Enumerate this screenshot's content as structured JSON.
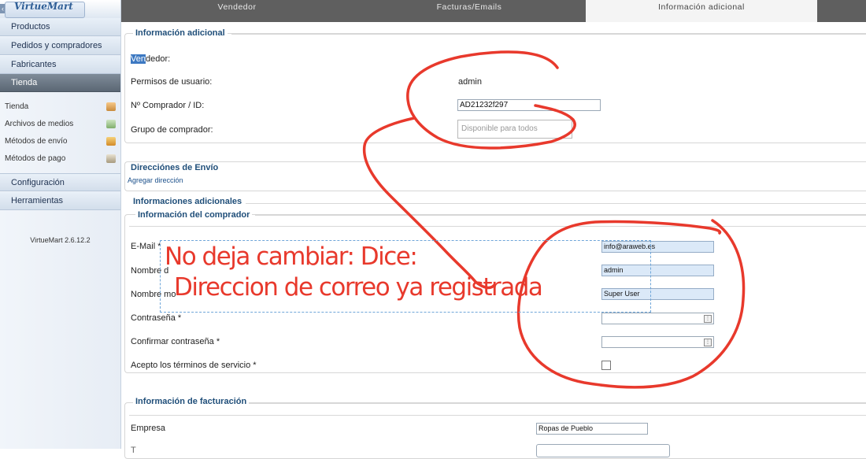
{
  "sidebar": {
    "logo": "VirtueMart",
    "nav_top": [
      "Productos",
      "Pedidos y compradores",
      "Fabricantes",
      "Tienda"
    ],
    "sub_items": [
      {
        "label": "Tienda",
        "icon": "store-icon"
      },
      {
        "label": "Archivos de medios",
        "icon": "media-icon"
      },
      {
        "label": "Métodos de envío",
        "icon": "truck-icon"
      },
      {
        "label": "Métodos de pago",
        "icon": "payment-icon"
      }
    ],
    "nav_bottom": [
      "Configuración",
      "Herramientas"
    ],
    "version": "VirtueMart 2.6.12.2"
  },
  "tabs": [
    "Vendedor",
    "Facturas/Emails",
    "Información adicional"
  ],
  "info_adicional": {
    "title": "Información adicional",
    "vendor_hl": "Ven",
    "vendor_rest": "dedor:",
    "permisos_label": "Permisos de usuario:",
    "permisos_value": "admin",
    "comprador_id_label": "Nº Comprador / ID:",
    "comprador_id_value": "AD21232f297",
    "grupo_label": "Grupo de comprador:",
    "grupo_placeholder": "Disponible para todos"
  },
  "envio": {
    "title": "Direcciónes de Envío",
    "add_link": "Agregar dirección"
  },
  "informaciones": {
    "title": "Informaciones adicionales",
    "sub_title": "Información del comprador",
    "email_label": "E-Mail *",
    "email_value": "info@araweb.es",
    "nombre_label": "Nombre d",
    "nombre_value": "admin",
    "nombre2_label": "Nombre mo",
    "nombre2_value": "Super User",
    "pass_label": "Contraseña *",
    "pass_confirm_label": "Confirmar contraseña *",
    "terms_label": "Acepto los términos de servicio *"
  },
  "facturacion": {
    "title": "Información de facturación",
    "empresa_label": "Empresa",
    "empresa_value": "Ropas de Pueblo"
  },
  "annotation": {
    "line1": "No deja cambiar: Dice:",
    "line2": "Direccion de correo ya registrada",
    "color": "#e8392c"
  },
  "colors": {
    "section_title": "#1f4e79",
    "tab_bar": "#5f5f5f",
    "active_nav": "#5b6774"
  }
}
